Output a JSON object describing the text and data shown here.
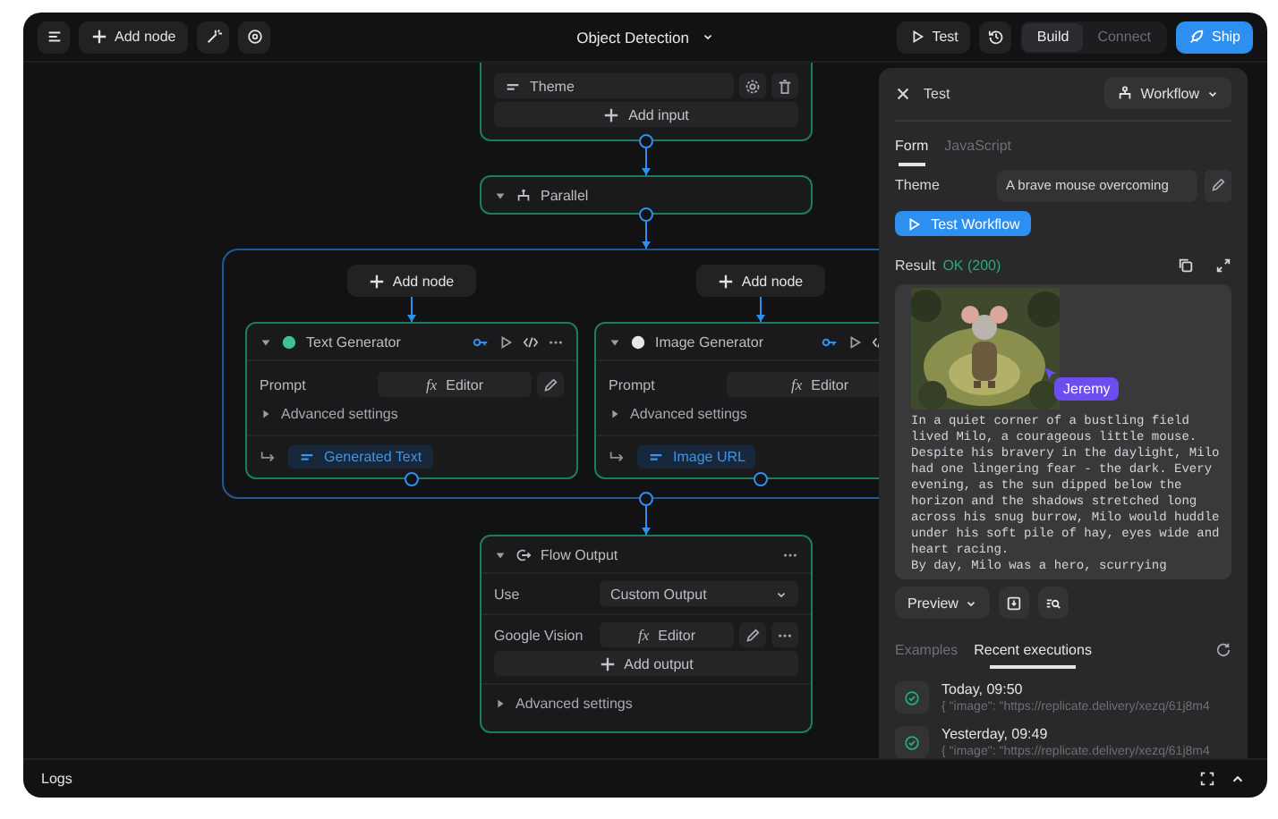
{
  "toolbar": {
    "add_node": "Add node",
    "title": "Object Detection",
    "test": "Test",
    "modes": [
      {
        "label": "Build",
        "selected": true
      },
      {
        "label": "Connect",
        "selected": false
      }
    ],
    "ship": "Ship"
  },
  "canvas": {
    "input_node": {
      "fields": [
        {
          "label": "Theme"
        }
      ],
      "add": "Add input"
    },
    "parallel": {
      "title": "Parallel",
      "expanded": true
    },
    "branches": [
      {
        "add_node": "Add node",
        "title": "Text Generator",
        "color": "#3ec28f",
        "expanded": true,
        "prompt_label": "Prompt",
        "editor_icon": "fx",
        "editor": "Editor",
        "advanced": {
          "label": "Advanced settings",
          "expanded": false
        },
        "output": "Generated Text"
      },
      {
        "add_node": "Add node",
        "title": "Image Generator",
        "color": "#e6e6e6",
        "expanded": true,
        "prompt_label": "Prompt",
        "editor_icon": "fx",
        "editor": "Editor",
        "advanced": {
          "label": "Advanced settings",
          "expanded": false
        },
        "output": "Image URL"
      }
    ],
    "flow_output": {
      "title": "Flow Output",
      "expanded": true,
      "use_label": "Use",
      "use_value": "Custom Output",
      "output_label": "Google Vision",
      "editor_icon": "fx",
      "editor": "Editor",
      "add": "Add output",
      "advanced": {
        "label": "Advanced settings",
        "expanded": false
      }
    }
  },
  "test_panel": {
    "title": "Test",
    "mode": "Workflow",
    "tabs": [
      {
        "label": "Form",
        "selected": true
      },
      {
        "label": "JavaScript",
        "selected": false
      }
    ],
    "theme_label": "Theme",
    "theme_value": "A brave mouse overcoming",
    "run": "Test Workflow",
    "result_label": "Result",
    "status": "OK (200)",
    "cursor_label": "Jeremy",
    "result_text": "In a quiet corner of a bustling field lived Milo, a courageous little mouse. Despite his bravery in the daylight, Milo had one lingering fear - the dark. Every evening, as the sun dipped below the horizon and the shadows stretched long across his snug burrow, Milo would huddle under his soft pile of hay, eyes wide and heart racing.\nBy day, Milo was a hero, scurrying",
    "preview": "Preview",
    "history_tabs": [
      {
        "label": "Examples",
        "selected": false
      },
      {
        "label": "Recent executions",
        "selected": true
      }
    ],
    "executions": [
      {
        "time": "Today, 09:50",
        "detail": "{ \"image\": \"https://replicate.delivery/xezq/61j8m4"
      },
      {
        "time": "Yesterday, 09:49",
        "detail": "{ \"image\": \"https://replicate.delivery/xezq/61j8m4"
      }
    ]
  },
  "logs": "Logs"
}
